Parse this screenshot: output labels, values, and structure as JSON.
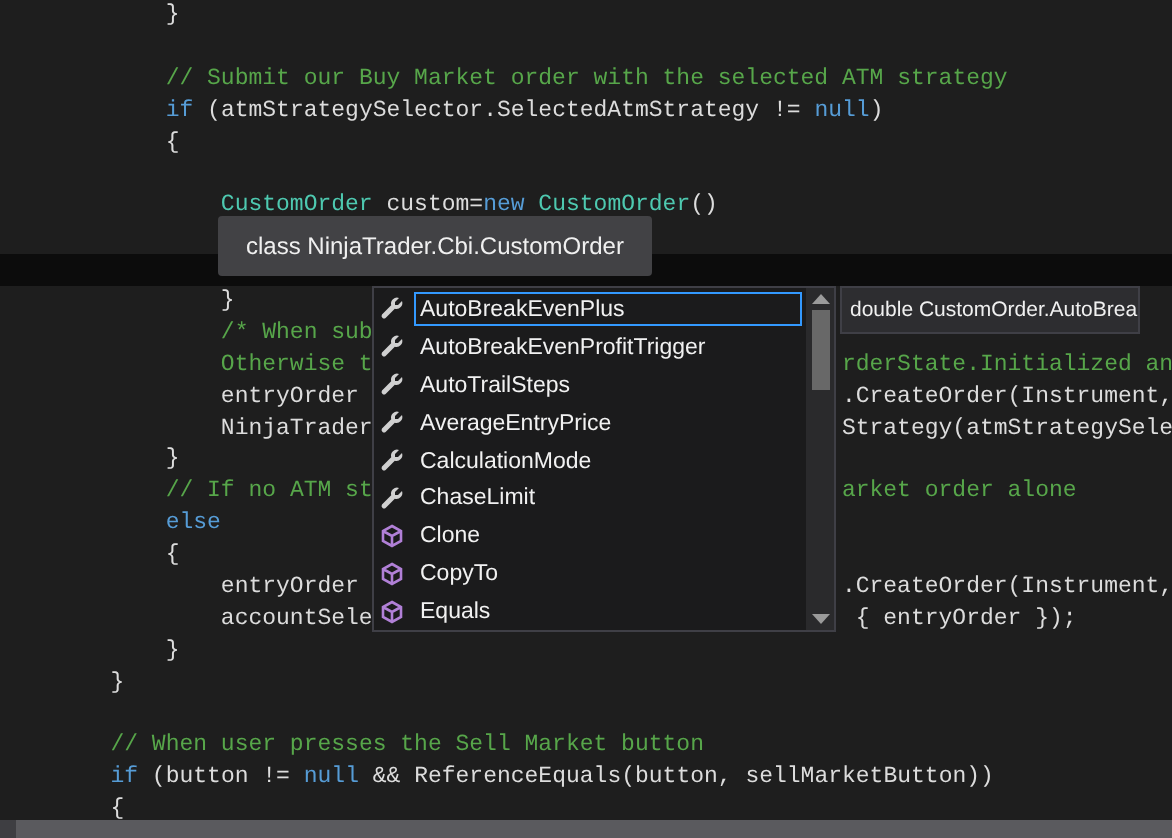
{
  "editor": {
    "lines": [
      {
        "highlighted": false,
        "tokens": [
          {
            "text": "            }",
            "kind": "plain"
          }
        ]
      },
      {
        "highlighted": false
      },
      {
        "highlighted": false,
        "tokens": [
          {
            "text": "            // Submit our Buy Market order with the selected ATM strategy",
            "kind": "comment"
          }
        ]
      },
      {
        "highlighted": false,
        "tokens": [
          {
            "text": "            if",
            "kind": "keyword"
          },
          {
            "text": " (atmStrategySelector.SelectedAtmStrategy != ",
            "kind": "plain"
          },
          {
            "text": "null",
            "kind": "keyword"
          },
          {
            "text": ")",
            "kind": "plain"
          }
        ]
      },
      {
        "highlighted": false,
        "tokens": [
          {
            "text": "            {",
            "kind": "plain"
          }
        ]
      },
      {
        "highlighted": false
      },
      {
        "highlighted": false,
        "tokens": [
          {
            "text": "                CustomOrder",
            "kind": "type"
          },
          {
            "text": " custom=",
            "kind": "plain"
          },
          {
            "text": "new",
            "kind": "keyword"
          },
          {
            "text": " CustomOrder",
            "kind": "type"
          },
          {
            "text": "()",
            "kind": "plain"
          }
        ]
      },
      {
        "highlighted": false
      },
      {
        "highlighted": true
      },
      {
        "highlighted": false,
        "tokens": [
          {
            "text": "                }",
            "kind": "plain"
          }
        ]
      },
      {
        "highlighted": false,
        "tokens": [
          {
            "text": "                /* When sub",
            "kind": "comment"
          }
        ]
      },
      {
        "highlighted": false,
        "tokens": [
          {
            "text": "                Otherwise t",
            "kind": "comment"
          }
        ],
        "right": [
          {
            "text": "rderState.Initialized an",
            "kind": "comment"
          }
        ]
      },
      {
        "highlighted": false,
        "tokens": [
          {
            "text": "                entryOrder",
            "kind": "plain"
          }
        ],
        "right": [
          {
            "text": ".CreateOrder(Instrument,",
            "kind": "plain"
          }
        ]
      },
      {
        "highlighted": false,
        "tokens": [
          {
            "text": "                NinjaTrader",
            "kind": "plain"
          }
        ],
        "right": [
          {
            "text": "Strategy(atmStrategySele",
            "kind": "plain"
          }
        ]
      },
      {
        "highlighted": false,
        "tokens": [
          {
            "text": "            }",
            "kind": "plain"
          }
        ]
      },
      {
        "highlighted": false,
        "tokens": [
          {
            "text": "            // If no ATM st",
            "kind": "comment"
          }
        ],
        "right": [
          {
            "text": "arket order alone",
            "kind": "comment"
          }
        ]
      },
      {
        "highlighted": false,
        "tokens": [
          {
            "text": "            else",
            "kind": "keyword"
          }
        ]
      },
      {
        "highlighted": false,
        "tokens": [
          {
            "text": "            {",
            "kind": "plain"
          }
        ]
      },
      {
        "highlighted": false,
        "tokens": [
          {
            "text": "                entryOrder",
            "kind": "plain"
          }
        ],
        "right": [
          {
            "text": ".CreateOrder(Instrument,",
            "kind": "plain"
          }
        ]
      },
      {
        "highlighted": false,
        "tokens": [
          {
            "text": "                accountSele",
            "kind": "plain"
          }
        ],
        "right": [
          {
            "text": " { entryOrder });",
            "kind": "plain"
          }
        ]
      },
      {
        "highlighted": false,
        "tokens": [
          {
            "text": "            }",
            "kind": "plain"
          }
        ]
      },
      {
        "highlighted": false,
        "tokens": [
          {
            "text": "        }",
            "kind": "plain"
          }
        ]
      },
      {
        "highlighted": false
      },
      {
        "highlighted": false,
        "tokens": [
          {
            "text": "        // When user presses the Sell Market button",
            "kind": "comment"
          }
        ]
      },
      {
        "highlighted": false,
        "tokens": [
          {
            "text": "        if",
            "kind": "keyword"
          },
          {
            "text": " (button != ",
            "kind": "plain"
          },
          {
            "text": "null",
            "kind": "keyword"
          },
          {
            "text": " && ReferenceEquals(button, sellMarketButton))",
            "kind": "plain"
          }
        ]
      },
      {
        "highlighted": false,
        "tokens": [
          {
            "text": "        {",
            "kind": "plain"
          }
        ]
      }
    ]
  },
  "type_tooltip": {
    "text": "class NinjaTrader.Cbi.CustomOrder"
  },
  "completion": {
    "items": [
      {
        "label": "AutoBreakEvenPlus",
        "kind": "property",
        "selected": true
      },
      {
        "label": "AutoBreakEvenProfitTrigger",
        "kind": "property",
        "selected": false
      },
      {
        "label": "AutoTrailSteps",
        "kind": "property",
        "selected": false
      },
      {
        "label": "AverageEntryPrice",
        "kind": "property",
        "selected": false
      },
      {
        "label": "CalculationMode",
        "kind": "property",
        "selected": false
      },
      {
        "label": "ChaseLimit",
        "kind": "property",
        "selected": false
      },
      {
        "label": "Clone",
        "kind": "method",
        "selected": false
      },
      {
        "label": "CopyTo",
        "kind": "method",
        "selected": false
      },
      {
        "label": "Equals",
        "kind": "method",
        "selected": false
      }
    ]
  },
  "detail_tooltip": {
    "text": "double CustomOrder.AutoBrea"
  }
}
